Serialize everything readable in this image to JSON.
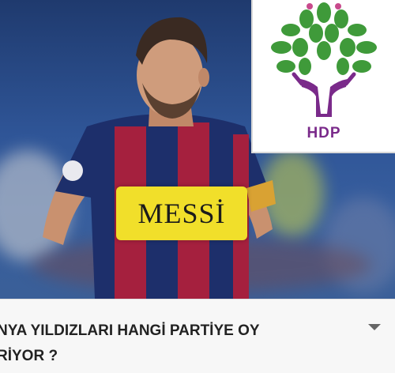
{
  "video": {
    "overlay_name": "MESSİ",
    "party_logo_text": "HDP",
    "title": "NYA YILDIZLARI HANGİ PARTİYE OY\nRİYOR ?"
  },
  "colors": {
    "badge_yellow": "#f1df2a",
    "logo_purple": "#7a2a8a",
    "logo_green": "#3f9a3a",
    "jersey_blue": "#1d2f6b",
    "jersey_red": "#a5203e"
  },
  "icons": {
    "expand": "chevron-down-icon",
    "logo": "hdp-tree-logo"
  }
}
